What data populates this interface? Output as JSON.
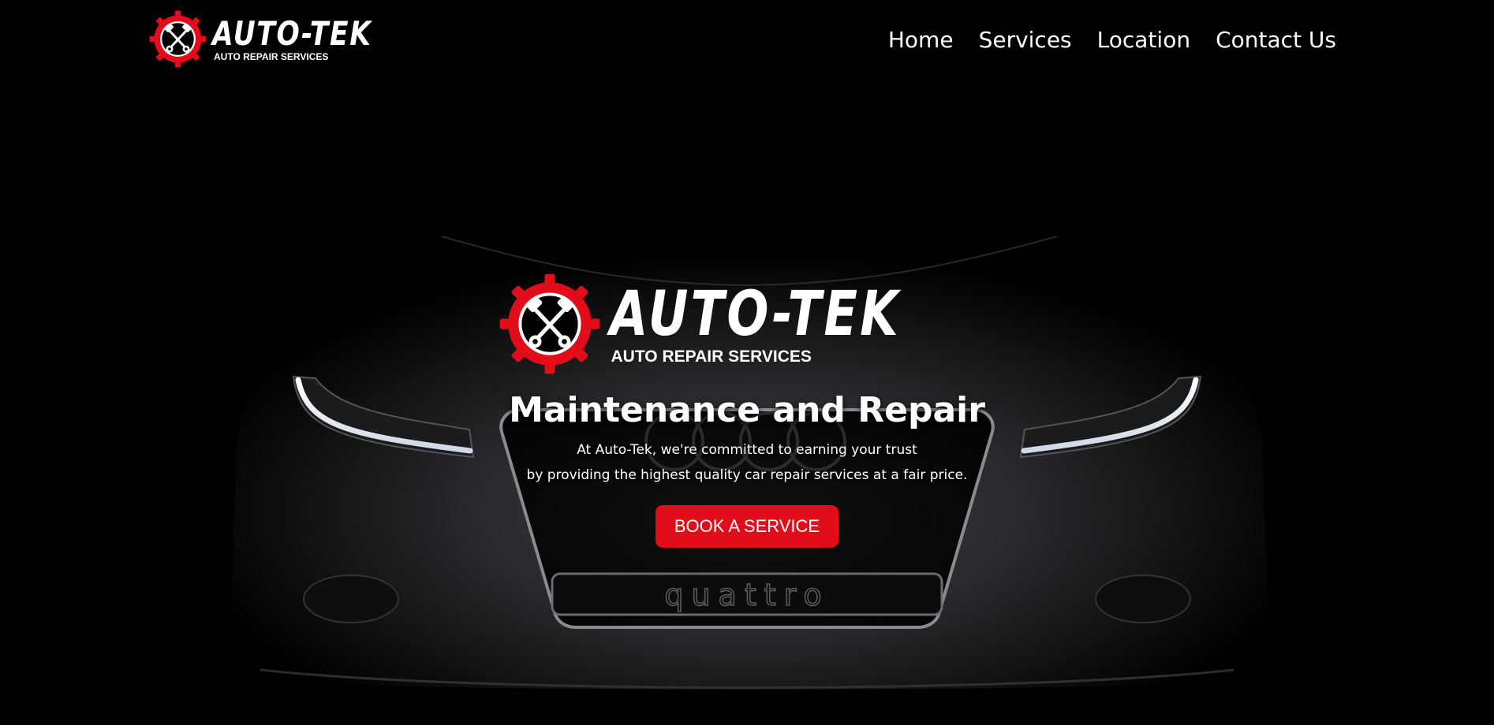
{
  "brand": {
    "name": "AUTO-TEK",
    "tagline": "AUTO REPAIR SERVICES"
  },
  "nav": {
    "items": [
      {
        "label": "Home"
      },
      {
        "label": "Services"
      },
      {
        "label": "Location"
      },
      {
        "label": "Contact Us"
      }
    ]
  },
  "hero": {
    "title": "Maintenance and Repair",
    "text_line1": "At Auto-Tek, we're committed to earning your trust",
    "text_line2": "by providing the highest quality car repair services at a fair price.",
    "cta_label": "BOOK A SERVICE",
    "grille_badge": "quattro"
  },
  "colors": {
    "accent": "#e20d1b",
    "background": "#000000",
    "text": "#ffffff"
  },
  "icons": {
    "logo": "gear-crossed-pistons-icon"
  }
}
